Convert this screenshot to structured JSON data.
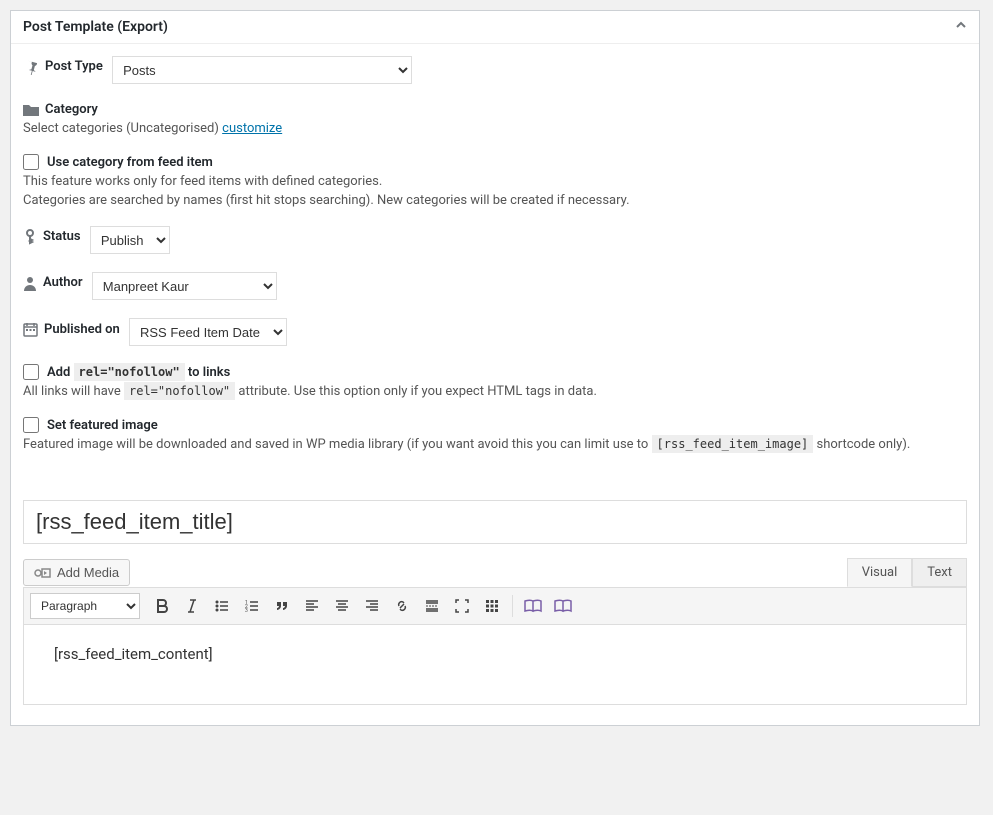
{
  "header": {
    "title": "Post Template (Export)"
  },
  "postType": {
    "label": "Post Type",
    "value": "Posts"
  },
  "category": {
    "label": "Category",
    "helpPrefix": "Select categories (Uncategorised) ",
    "customizeLink": "customize"
  },
  "useCategory": {
    "label": "Use category from feed item",
    "help1": "This feature works only for feed items with defined categories.",
    "help2": "Categories are searched by names (first hit stops searching). New categories will be created if necessary."
  },
  "status": {
    "label": "Status",
    "value": "Publish"
  },
  "author": {
    "label": "Author",
    "value": "Manpreet Kaur"
  },
  "published": {
    "label": "Published on",
    "value": "RSS Feed Item Date"
  },
  "nofollow": {
    "labelPrefix": "Add ",
    "code": "rel=\"nofollow\"",
    "labelSuffix": " to links",
    "helpPrefix": "All links will have ",
    "helpCode": "rel=\"nofollow\"",
    "helpSuffix": " attribute. Use this option only if you expect HTML tags in data."
  },
  "featured": {
    "label": "Set featured image",
    "helpPrefix": "Featured image will be downloaded and saved in WP media library (if you want avoid this you can limit use to ",
    "helpCode": "[rss_feed_item_image]",
    "helpSuffix": " shortcode only)."
  },
  "titleField": {
    "value": "[rss_feed_item_title]"
  },
  "addMedia": {
    "label": "Add Media"
  },
  "tabs": {
    "visual": "Visual",
    "text": "Text"
  },
  "format": {
    "value": "Paragraph"
  },
  "content": {
    "value": "[rss_feed_item_content]"
  }
}
